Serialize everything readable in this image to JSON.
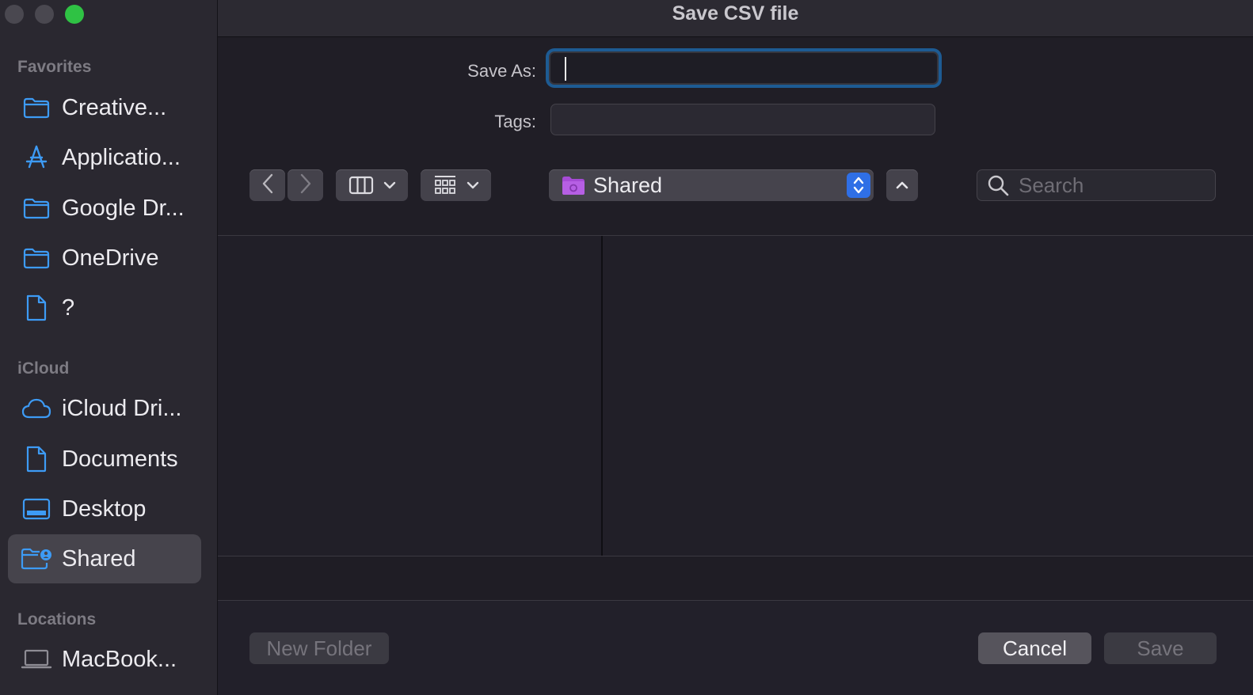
{
  "window": {
    "title": "Save CSV file"
  },
  "sidebar": {
    "sections": [
      {
        "title": "Favorites",
        "items": [
          {
            "label": "Creative...",
            "icon": "folder-icon"
          },
          {
            "label": "Applicatio...",
            "icon": "applications-icon"
          },
          {
            "label": "Google Dr...",
            "icon": "folder-icon"
          },
          {
            "label": "OneDrive",
            "icon": "folder-icon"
          },
          {
            "label": "?",
            "icon": "document-icon"
          }
        ]
      },
      {
        "title": "iCloud",
        "items": [
          {
            "label": "iCloud Dri...",
            "icon": "cloud-icon"
          },
          {
            "label": "Documents",
            "icon": "document-icon"
          },
          {
            "label": "Desktop",
            "icon": "desktop-icon"
          },
          {
            "label": "Shared",
            "icon": "shared-folder-icon",
            "selected": true
          }
        ]
      },
      {
        "title": "Locations",
        "items": [
          {
            "label": "MacBook...",
            "icon": "laptop-icon"
          }
        ]
      }
    ]
  },
  "form": {
    "save_as_label": "Save As:",
    "save_as_value": "",
    "tags_label": "Tags:",
    "tags_value": ""
  },
  "toolbar": {
    "location": "Shared",
    "search_placeholder": "Search"
  },
  "buttons": {
    "new_folder": "New Folder",
    "cancel": "Cancel",
    "save": "Save"
  },
  "colors": {
    "accent": "#2f6fe6",
    "focus_ring": "#1d5b93",
    "sidebar_icon": "#3d9bf5",
    "close_button": "#4a4850",
    "zoom_button": "#2fc244"
  }
}
